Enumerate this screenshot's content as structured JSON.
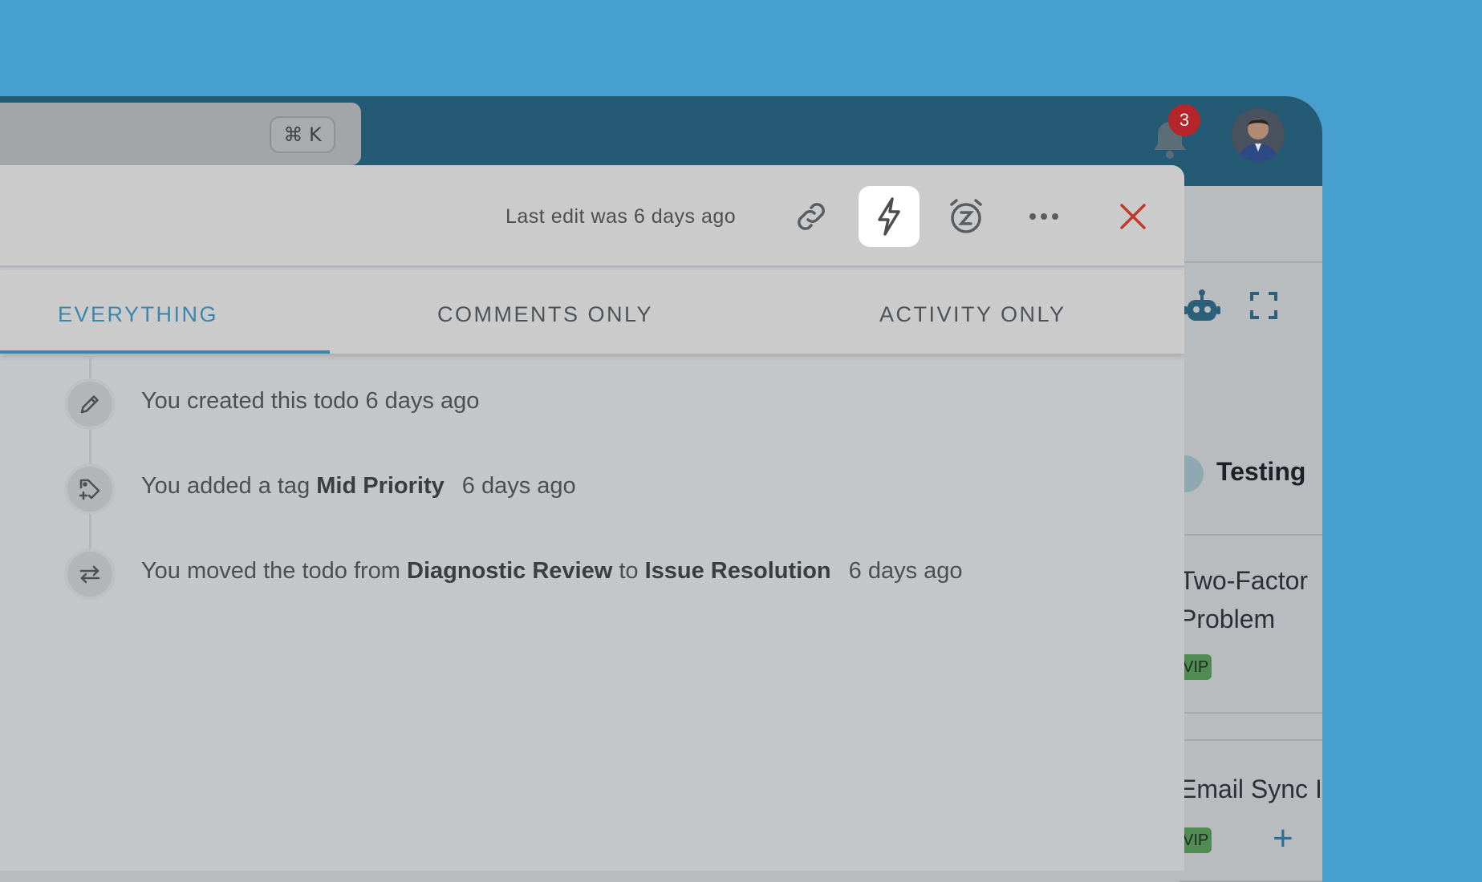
{
  "header": {
    "search_shortcut": "⌘ K",
    "notification_count": "3"
  },
  "board": {
    "column_title": "Testing",
    "cards": [
      {
        "title_line1": "Two-Factor",
        "title_line2": "Problem",
        "tag": "VIP"
      },
      {
        "title_line1": "Email Sync Is",
        "tag": "VIP"
      }
    ]
  },
  "modal": {
    "last_edit": "Last edit was 6 days ago",
    "tabs": [
      {
        "label": "EVERYTHING",
        "active": true
      },
      {
        "label": "COMMENTS ONLY",
        "active": false
      },
      {
        "label": "ACTIVITY ONLY",
        "active": false
      }
    ],
    "events": [
      {
        "icon": "pencil-icon",
        "text": "You created this todo 6 days ago"
      },
      {
        "icon": "tag-add-icon",
        "prefix": "You added a tag ",
        "tag": "Mid Priority",
        "time": "6 days ago"
      },
      {
        "icon": "move-arrows-icon",
        "prefix": "You moved the todo from ",
        "from": "Diagnostic Review",
        "middle": " to ",
        "to": "Issue Resolution",
        "time": "6 days ago"
      }
    ]
  },
  "colors": {
    "accent": "#3c86ad",
    "close": "#c0392b",
    "header": "#245a73",
    "badge": "#b5262b"
  }
}
